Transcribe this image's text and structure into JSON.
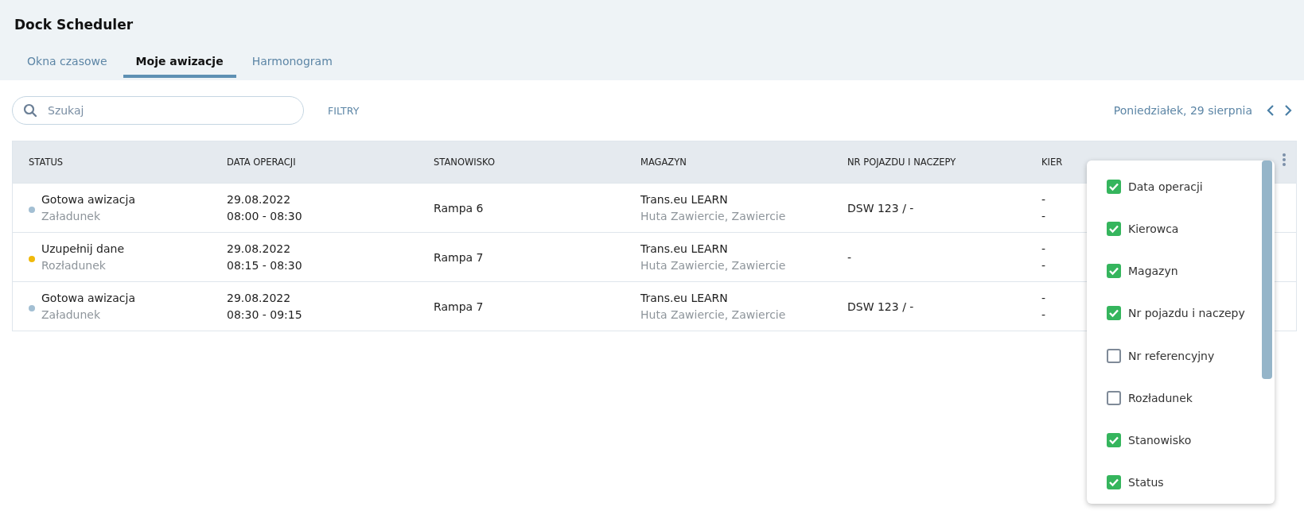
{
  "app": {
    "title": "Dock Scheduler"
  },
  "tabs": [
    {
      "label": "Okna czasowe",
      "selected": false
    },
    {
      "label": "Moje awizacje",
      "selected": true
    },
    {
      "label": "Harmonogram",
      "selected": false
    }
  ],
  "search": {
    "placeholder": "Szukaj"
  },
  "filters_button": "FILTRY",
  "date_nav": {
    "date": "Poniedziałek, 29 sierpnia"
  },
  "table": {
    "columns": [
      "STATUS",
      "DATA OPERACJI",
      "STANOWISKO",
      "MAGAZYN",
      "NR POJAZDU I NACZEPY",
      "KIER"
    ],
    "rows": [
      {
        "status": "Gotowa awizacja",
        "type": "Załadunek",
        "color": "#a3bfd3",
        "date": "29.08.2022",
        "time": "08:00 - 08:30",
        "station": "Rampa 6",
        "warehouse": "Trans.eu LEARN",
        "location": "Huta Zawiercie, Zawiercie",
        "vehicle": "DSW 123 / -",
        "driver": [
          "-",
          "-"
        ]
      },
      {
        "status": "Uzupełnij dane",
        "type": "Rozładunek",
        "color": "#f0b90b",
        "date": "29.08.2022",
        "time": "08:15 - 08:30",
        "station": "Rampa 7",
        "warehouse": "Trans.eu LEARN",
        "location": "Huta Zawiercie, Zawiercie",
        "vehicle": "-",
        "driver": [
          "-",
          "-"
        ]
      },
      {
        "status": "Gotowa awizacja",
        "type": "Załadunek",
        "color": "#a3bfd3",
        "date": "29.08.2022",
        "time": "08:30 - 09:15",
        "station": "Rampa 7",
        "warehouse": "Trans.eu LEARN",
        "location": "Huta Zawiercie, Zawiercie",
        "vehicle": "DSW 123 / -",
        "driver": [
          "-",
          "-"
        ]
      }
    ]
  },
  "column_menu": {
    "items": [
      {
        "label": "Data operacji",
        "checked": true
      },
      {
        "label": "Kierowca",
        "checked": true
      },
      {
        "label": "Magazyn",
        "checked": true
      },
      {
        "label": "Nr pojazdu i naczepy",
        "checked": true
      },
      {
        "label": "Nr referencyjny",
        "checked": false
      },
      {
        "label": "Rozładunek",
        "checked": false
      },
      {
        "label": "Stanowisko",
        "checked": true
      },
      {
        "label": "Status",
        "checked": true
      }
    ]
  }
}
